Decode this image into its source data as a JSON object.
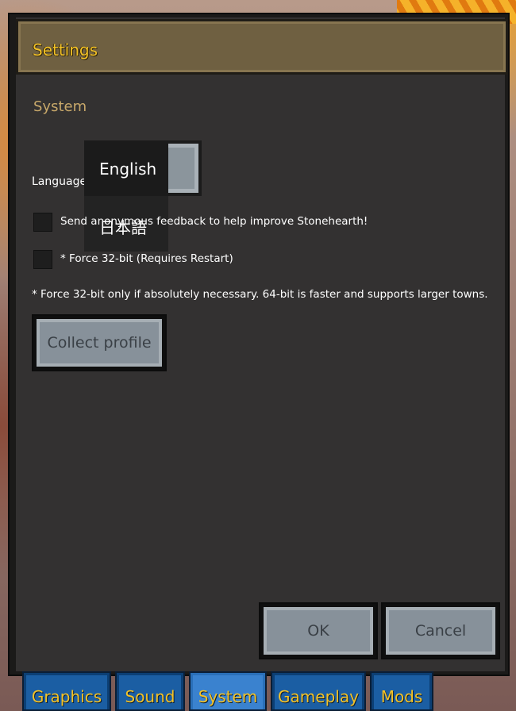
{
  "window": {
    "title": "Settings"
  },
  "section": {
    "title": "System"
  },
  "language": {
    "label": "Language",
    "options": [
      "English",
      "日本語"
    ],
    "selected": "English"
  },
  "checkboxes": [
    {
      "label": "Send anonymous feedback to help improve Stonehearth!",
      "checked": false
    },
    {
      "label": "* Force 32-bit (Requires Restart)",
      "checked": false
    }
  ],
  "note": "* Force 32-bit only if absolutely necessary. 64-bit is faster and supports larger towns.",
  "buttons": {
    "collect_profile": "Collect profile",
    "ok": "OK",
    "cancel": "Cancel"
  },
  "tabs": [
    {
      "label": "Graphics",
      "active": false
    },
    {
      "label": "Sound",
      "active": false
    },
    {
      "label": "System",
      "active": true
    },
    {
      "label": "Gameplay",
      "active": false
    },
    {
      "label": "Mods",
      "active": false
    }
  ],
  "colors": {
    "title_text": "#f3c227",
    "panel_bg": "#333131",
    "titlebar_bg": "#6f6041",
    "tab_bg": "#1b5ea3",
    "button_face": "#87919a"
  }
}
